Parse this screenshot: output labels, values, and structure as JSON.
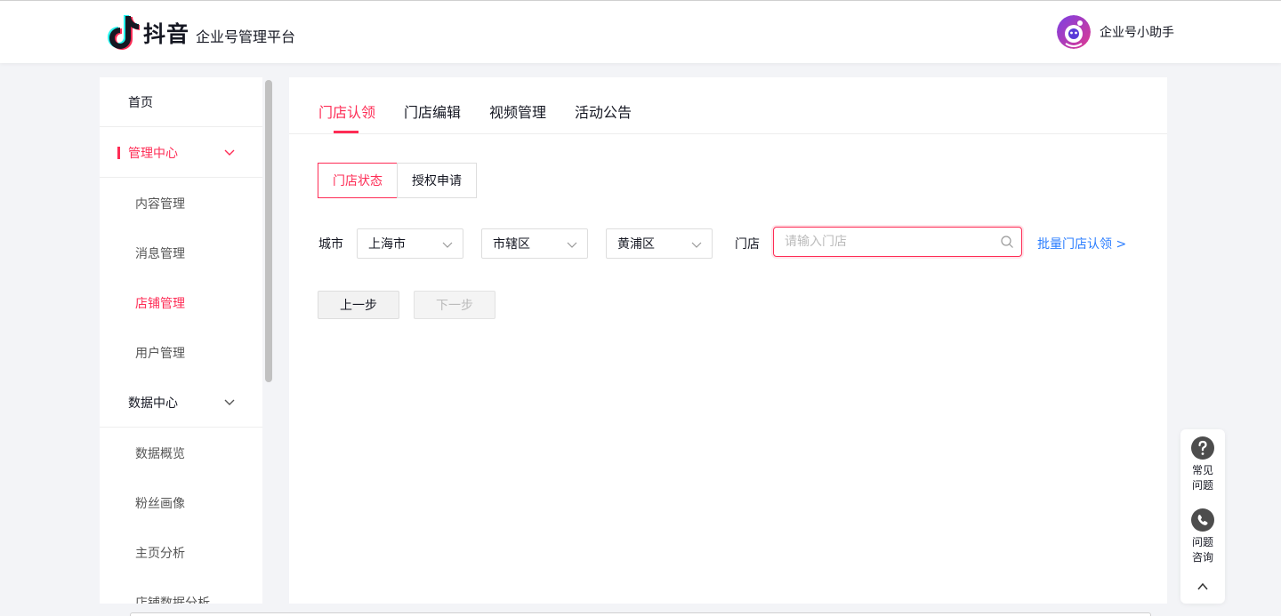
{
  "header": {
    "brand": "抖音",
    "platform_title": "企业号管理平台",
    "user_name": "企业号小助手"
  },
  "sidebar": {
    "home": "首页",
    "manage_center": "管理中心",
    "manage_items": [
      "内容管理",
      "消息管理",
      "店铺管理",
      "用户管理"
    ],
    "data_center": "数据中心",
    "data_items": [
      "数据概览",
      "粉丝画像",
      "主页分析",
      "店铺数据分析"
    ]
  },
  "tabs": [
    "门店认领",
    "门店编辑",
    "视频管理",
    "活动公告"
  ],
  "segments": [
    "门店状态",
    "授权申请"
  ],
  "filters": {
    "city_label": "城市",
    "city": "上海市",
    "district_type": "市辖区",
    "district": "黄浦区",
    "store_label": "门店",
    "store_placeholder": "请输入门店",
    "batch_link": "批量门店认领 >"
  },
  "buttons": {
    "prev": "上一步",
    "next": "下一步"
  },
  "help": {
    "faq_line1": "常见",
    "faq_line2": "问题",
    "consult_line1": "问题",
    "consult_line2": "咨询"
  },
  "colors": {
    "accent": "#fe2c55",
    "link": "#2a7dff",
    "background": "#f3f4f7"
  }
}
